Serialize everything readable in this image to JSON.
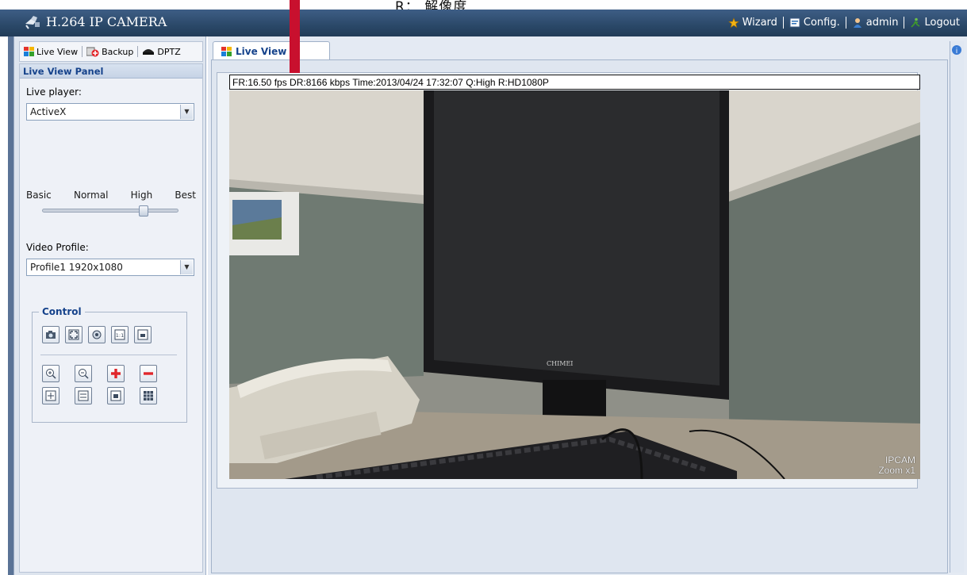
{
  "annotation": {
    "text": "R：  解像度"
  },
  "titlebar": {
    "title": "H.264 IP CAMERA",
    "nav": [
      {
        "label": "Wizard",
        "icon": "wizard-star-icon"
      },
      {
        "label": "Config.",
        "icon": "config-icon"
      },
      {
        "label": "admin",
        "icon": "user-icon"
      },
      {
        "label": "Logout",
        "icon": "logout-icon"
      }
    ]
  },
  "left_tabs": [
    {
      "label": "Live View",
      "icon": "live-view-icon"
    },
    {
      "label": "Backup",
      "icon": "backup-icon"
    },
    {
      "label": "DPTZ",
      "icon": "dptz-camera-icon"
    }
  ],
  "panel": {
    "header": "Live View Panel",
    "live_player_label": "Live player:",
    "live_player_value": "ActiveX",
    "quality_levels": [
      "Basic",
      "Normal",
      "High",
      "Best"
    ],
    "quality_selected": "High",
    "video_profile_label": "Video Profile:",
    "video_profile_value": "Profile1 1920x1080",
    "control_title": "Control"
  },
  "main": {
    "tab_label": "Live View",
    "osd_text": "FR:16.50 fps  DR:8166 kbps Time:2013/04/24 17:32:07 Q:High R:HD1080P",
    "cam_name": "IPCAM",
    "zoom_text": "Zoom x1",
    "monitor_brand": "CHIMEI"
  },
  "colors": {
    "titlebar": "#2a4868",
    "accent_red": "#c8102e",
    "panel_header_text": "#15428b"
  }
}
